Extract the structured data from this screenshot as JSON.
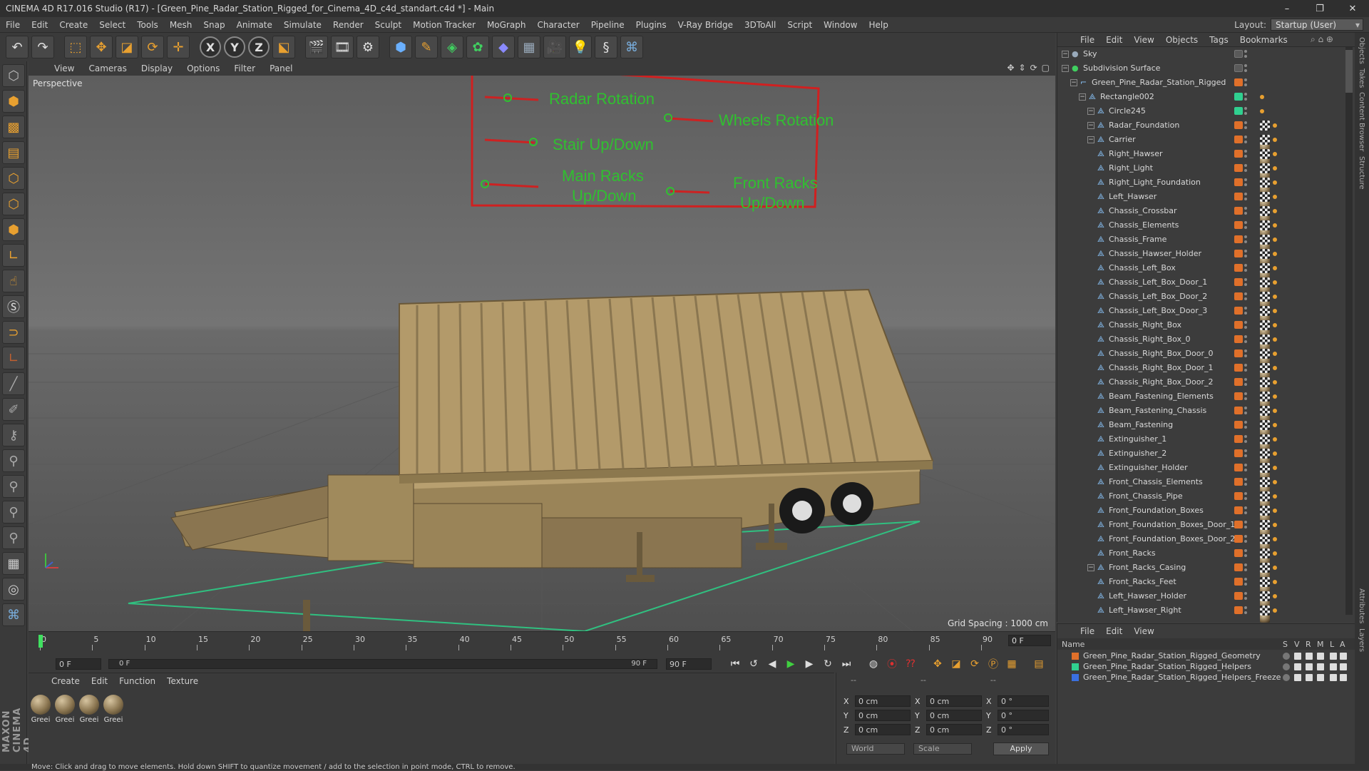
{
  "window": {
    "title": "CINEMA 4D R17.016 Studio (R17) - [Green_Pine_Radar_Station_Rigged_for_Cinema_4D_c4d_standart.c4d *] - Main"
  },
  "menubar": [
    "File",
    "Edit",
    "Create",
    "Select",
    "Tools",
    "Mesh",
    "Snap",
    "Animate",
    "Simulate",
    "Render",
    "Sculpt",
    "Motion Tracker",
    "MoGraph",
    "Character",
    "Pipeline",
    "Plugins",
    "V-Ray Bridge",
    "3DToAll",
    "Script",
    "Window",
    "Help"
  ],
  "layout": {
    "label": "Layout:",
    "value": "Startup (User)"
  },
  "toolbar": {
    "icons": [
      "undo-icon",
      "redo-icon",
      "live-selection-icon",
      "move-icon",
      "scale-icon",
      "rotate-icon",
      "multi-transform-icon",
      "x-axis-icon",
      "y-axis-icon",
      "z-axis-icon",
      "world-coordinates-icon",
      "render-view-icon",
      "render-picture-viewer-icon",
      "edit-render-settings-icon",
      "cube-icon",
      "pen-spline-icon",
      "subdivision-surface-icon",
      "cloner-icon",
      "deformer-icon",
      "floor-icon",
      "camera-icon",
      "light-icon",
      "cinema-swirl-icon",
      "python-icon"
    ],
    "axis_labels": [
      "X",
      "Y",
      "Z"
    ]
  },
  "left_tools": [
    "make-editable-icon",
    "model-mode-icon",
    "texture-mode-icon",
    "workplane-icon",
    "points-mode-icon",
    "edges-mode-icon",
    "polygons-mode-icon",
    "axis-mode-icon",
    "tweak-mode-icon",
    "solo-icon",
    "snap-icon",
    "locked-workplane-icon",
    "planar-workplane-icon",
    "paint-icon",
    "knife-icon",
    "extrude-icon",
    "bevel-icon",
    "bridge-icon",
    "magnet-icon",
    "brush-icon",
    "grid-icon",
    "animation-icon",
    "python-icon"
  ],
  "viewport": {
    "menu": [
      "View",
      "Cameras",
      "Display",
      "Options",
      "Filter",
      "Panel"
    ],
    "label": "Perspective",
    "grid_spacing": "Grid Spacing : 1000 cm",
    "annotations": {
      "radar_rotation": "Radar Rotation",
      "wheels_rotation": "Wheels Rotation",
      "stair_updown": "Stair Up/Down",
      "main_racks_line1": "Main Racks",
      "main_racks_line2": "Up/Down",
      "front_racks_line1": "Front Racks",
      "front_racks_line2": "Up/Down"
    }
  },
  "timeline": {
    "ticks": [
      "0",
      "5",
      "10",
      "15",
      "20",
      "25",
      "30",
      "35",
      "40",
      "45",
      "50",
      "55",
      "60",
      "65",
      "70",
      "75",
      "80",
      "85",
      "90"
    ],
    "current_frame": "0 F"
  },
  "transport": {
    "start": "0 F",
    "range_start": "0 F",
    "range_end": "90 F",
    "end": "90 F"
  },
  "material_panel": {
    "menu": [
      "Create",
      "Edit",
      "Function",
      "Texture"
    ],
    "materials": [
      "Greei",
      "Greei",
      "Greei",
      "Greei"
    ]
  },
  "coordinates": {
    "header_left": "--",
    "header_mid": "--",
    "header_right": "--",
    "rows": [
      {
        "axis": "X",
        "pos": "0 cm",
        "size_axis": "X",
        "size": "0 cm",
        "rot_axis": "X",
        "rot": "0 °"
      },
      {
        "axis": "Y",
        "pos": "0 cm",
        "size_axis": "Y",
        "size": "0 cm",
        "rot_axis": "Y",
        "rot": "0 °"
      },
      {
        "axis": "Z",
        "pos": "0 cm",
        "size_axis": "Z",
        "size": "0 cm",
        "rot_axis": "Z",
        "rot": "0 °"
      }
    ],
    "mode": "World",
    "size_mode": "Scale",
    "apply": "Apply"
  },
  "status": "Move: Click and drag to move elements. Hold down SHIFT to quantize movement / add to the selection in point mode, CTRL to remove.",
  "object_manager": {
    "menu": [
      "File",
      "Edit",
      "View",
      "Objects",
      "Tags",
      "Bookmarks"
    ],
    "objects": [
      {
        "name": "Sky",
        "depth": 0,
        "layer": "",
        "tags": []
      },
      {
        "name": "Subdivision Surface",
        "depth": 0,
        "layer": "",
        "tags": []
      },
      {
        "name": "Green_Pine_Radar_Station_Rigged",
        "depth": 1,
        "layer": "#e0702a",
        "tags": []
      },
      {
        "name": "Rectangle002",
        "depth": 2,
        "layer": "#30d090",
        "tags": [
          "sel"
        ]
      },
      {
        "name": "Circle245",
        "depth": 3,
        "layer": "#30d090",
        "tags": [
          "sel"
        ]
      },
      {
        "name": "Radar_Foundation",
        "depth": 3,
        "layer": "#e0702a",
        "tags": [
          "mat",
          "chk",
          "sel"
        ]
      },
      {
        "name": "Carrier",
        "depth": 3,
        "layer": "#e0702a",
        "tags": [
          "mat",
          "chk",
          "sel"
        ]
      },
      {
        "name": "Right_Hawser",
        "depth": 3,
        "layer": "#e0702a",
        "tags": [
          "mat",
          "chk",
          "sel"
        ]
      },
      {
        "name": "Right_Light",
        "depth": 3,
        "layer": "#e0702a",
        "tags": [
          "mat",
          "chk",
          "sel"
        ]
      },
      {
        "name": "Right_Light_Foundation",
        "depth": 3,
        "layer": "#e0702a",
        "tags": [
          "mat",
          "chk",
          "sel"
        ]
      },
      {
        "name": "Left_Hawser",
        "depth": 3,
        "layer": "#e0702a",
        "tags": [
          "mat",
          "chk",
          "sel"
        ]
      },
      {
        "name": "Chassis_Crossbar",
        "depth": 3,
        "layer": "#e0702a",
        "tags": [
          "mat",
          "chk",
          "sel"
        ]
      },
      {
        "name": "Chassis_Elements",
        "depth": 3,
        "layer": "#e0702a",
        "tags": [
          "mat",
          "chk",
          "sel"
        ]
      },
      {
        "name": "Chassis_Frame",
        "depth": 3,
        "layer": "#e0702a",
        "tags": [
          "mat",
          "chk",
          "sel"
        ]
      },
      {
        "name": "Chassis_Hawser_Holder",
        "depth": 3,
        "layer": "#e0702a",
        "tags": [
          "mat",
          "chk",
          "sel"
        ]
      },
      {
        "name": "Chassis_Left_Box",
        "depth": 3,
        "layer": "#e0702a",
        "tags": [
          "mat",
          "chk",
          "sel"
        ]
      },
      {
        "name": "Chassis_Left_Box_Door_1",
        "depth": 3,
        "layer": "#e0702a",
        "tags": [
          "mat",
          "chk",
          "sel"
        ]
      },
      {
        "name": "Chassis_Left_Box_Door_2",
        "depth": 3,
        "layer": "#e0702a",
        "tags": [
          "mat",
          "chk",
          "sel"
        ]
      },
      {
        "name": "Chassis_Left_Box_Door_3",
        "depth": 3,
        "layer": "#e0702a",
        "tags": [
          "mat",
          "chk",
          "sel"
        ]
      },
      {
        "name": "Chassis_Right_Box",
        "depth": 3,
        "layer": "#e0702a",
        "tags": [
          "mat",
          "chk",
          "sel"
        ]
      },
      {
        "name": "Chassis_Right_Box_0",
        "depth": 3,
        "layer": "#e0702a",
        "tags": [
          "mat",
          "chk",
          "sel"
        ]
      },
      {
        "name": "Chassis_Right_Box_Door_0",
        "depth": 3,
        "layer": "#e0702a",
        "tags": [
          "mat",
          "chk",
          "sel"
        ]
      },
      {
        "name": "Chassis_Right_Box_Door_1",
        "depth": 3,
        "layer": "#e0702a",
        "tags": [
          "mat",
          "chk",
          "sel"
        ]
      },
      {
        "name": "Chassis_Right_Box_Door_2",
        "depth": 3,
        "layer": "#e0702a",
        "tags": [
          "mat",
          "chk",
          "sel"
        ]
      },
      {
        "name": "Beam_Fastening_Elements",
        "depth": 3,
        "layer": "#e0702a",
        "tags": [
          "mat",
          "chk",
          "sel"
        ]
      },
      {
        "name": "Beam_Fastening_Chassis",
        "depth": 3,
        "layer": "#e0702a",
        "tags": [
          "mat",
          "chk",
          "sel"
        ]
      },
      {
        "name": "Beam_Fastening",
        "depth": 3,
        "layer": "#e0702a",
        "tags": [
          "mat",
          "chk",
          "sel"
        ]
      },
      {
        "name": "Extinguisher_1",
        "depth": 3,
        "layer": "#e0702a",
        "tags": [
          "mat",
          "chk",
          "sel"
        ]
      },
      {
        "name": "Extinguisher_2",
        "depth": 3,
        "layer": "#e0702a",
        "tags": [
          "mat",
          "chk",
          "sel"
        ]
      },
      {
        "name": "Extinguisher_Holder",
        "depth": 3,
        "layer": "#e0702a",
        "tags": [
          "mat",
          "chk",
          "sel"
        ]
      },
      {
        "name": "Front_Chassis_Elements",
        "depth": 3,
        "layer": "#e0702a",
        "tags": [
          "mat",
          "chk",
          "sel"
        ]
      },
      {
        "name": "Front_Chassis_Pipe",
        "depth": 3,
        "layer": "#e0702a",
        "tags": [
          "mat",
          "chk",
          "sel"
        ]
      },
      {
        "name": "Front_Foundation_Boxes",
        "depth": 3,
        "layer": "#e0702a",
        "tags": [
          "mat",
          "chk",
          "sel"
        ]
      },
      {
        "name": "Front_Foundation_Boxes_Door_1",
        "depth": 3,
        "layer": "#e0702a",
        "tags": [
          "mat",
          "chk",
          "sel"
        ]
      },
      {
        "name": "Front_Foundation_Boxes_Door_2",
        "depth": 3,
        "layer": "#e0702a",
        "tags": [
          "mat",
          "chk",
          "sel"
        ]
      },
      {
        "name": "Front_Racks",
        "depth": 3,
        "layer": "#e0702a",
        "tags": [
          "mat",
          "chk",
          "sel"
        ]
      },
      {
        "name": "Front_Racks_Casing",
        "depth": 3,
        "layer": "#e0702a",
        "tags": [
          "mat",
          "chk",
          "sel"
        ]
      },
      {
        "name": "Front_Racks_Feet",
        "depth": 3,
        "layer": "#e0702a",
        "tags": [
          "mat",
          "chk",
          "sel"
        ]
      },
      {
        "name": "Left_Hawser_Holder",
        "depth": 3,
        "layer": "#e0702a",
        "tags": [
          "mat",
          "chk",
          "sel"
        ]
      },
      {
        "name": "Left_Hawser_Right",
        "depth": 3,
        "layer": "#e0702a",
        "tags": [
          "mat",
          "chk",
          "sel"
        ]
      }
    ]
  },
  "layer_manager": {
    "menu": [
      "File",
      "Edit",
      "View"
    ],
    "columns": [
      "Name",
      "S",
      "V",
      "R",
      "M",
      "L",
      "A"
    ],
    "layers": [
      {
        "name": "Green_Pine_Radar_Station_Rigged_Geometry",
        "color": "#e0702a"
      },
      {
        "name": "Green_Pine_Radar_Station_Rigged_Helpers",
        "color": "#30d090"
      },
      {
        "name": "Green_Pine_Radar_Station_Rigged_Helpers_Freeze",
        "color": "#3a70e0"
      }
    ]
  },
  "right_strip_tabs": [
    "Objects",
    "Takes",
    "Content Browser",
    "Structure",
    "Attributes",
    "Layers"
  ],
  "colors": {
    "accent": "#e8a030",
    "annotation": "#30c030",
    "annotation_frame": "#d02020"
  }
}
